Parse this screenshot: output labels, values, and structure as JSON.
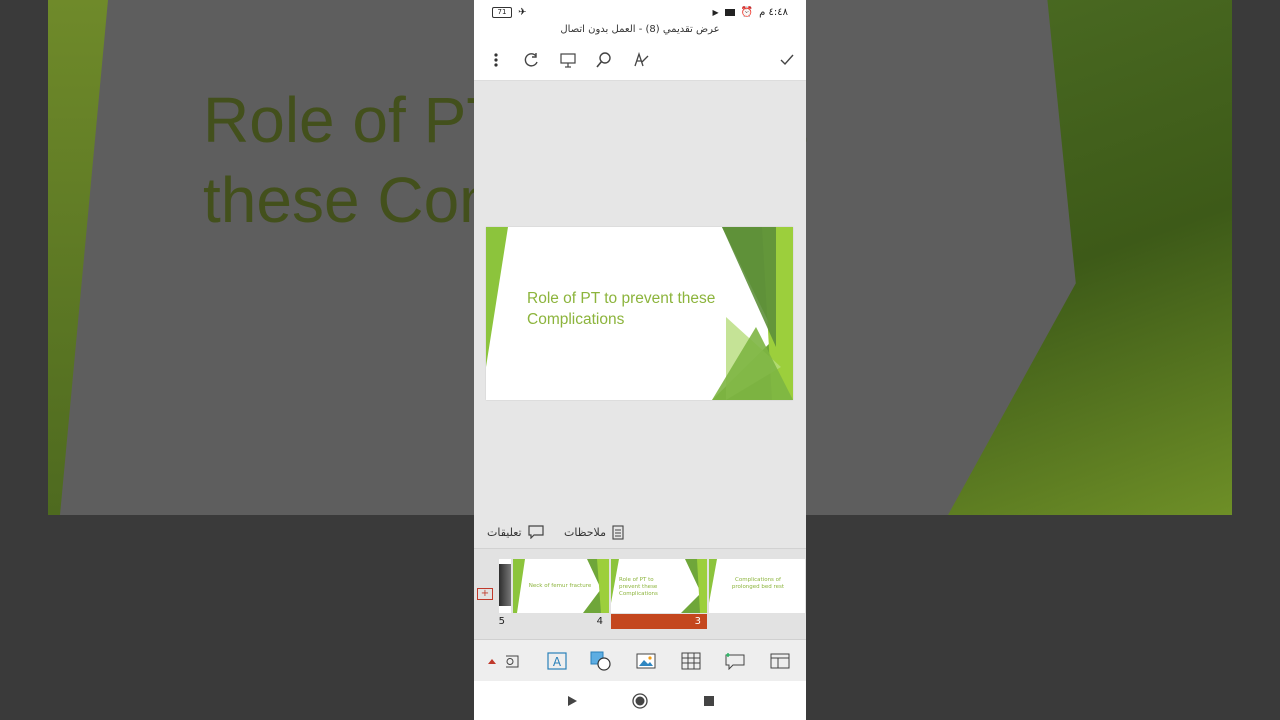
{
  "status": {
    "time": "٤:٤٨ م",
    "battery": "71"
  },
  "doc_title": "عرض تقديمي (8) - العمل بدون اتصال",
  "toolbar": {
    "icons": [
      "more-icon",
      "redo-icon",
      "present-icon",
      "search-icon",
      "draw-icon",
      "done-icon"
    ]
  },
  "slide": {
    "title": "Role of PT to prevent these Complications"
  },
  "background_slide_title": "Role of PT to prevent these Complications",
  "tabs": {
    "comments": "تعليقات",
    "notes": "ملاحظات"
  },
  "thumbnails": [
    {
      "number": "5",
      "text": "",
      "selected": false
    },
    {
      "number": "4",
      "text": "Neck of femur fracture",
      "selected": false
    },
    {
      "number": "3",
      "text": "Role of PT to prevent these Complications",
      "selected": true
    },
    {
      "number": "",
      "text": "Complications of prolonged bed rest",
      "selected": false
    }
  ],
  "colors": {
    "accent": "#c4471e",
    "slide_green": "#8cb43c"
  }
}
